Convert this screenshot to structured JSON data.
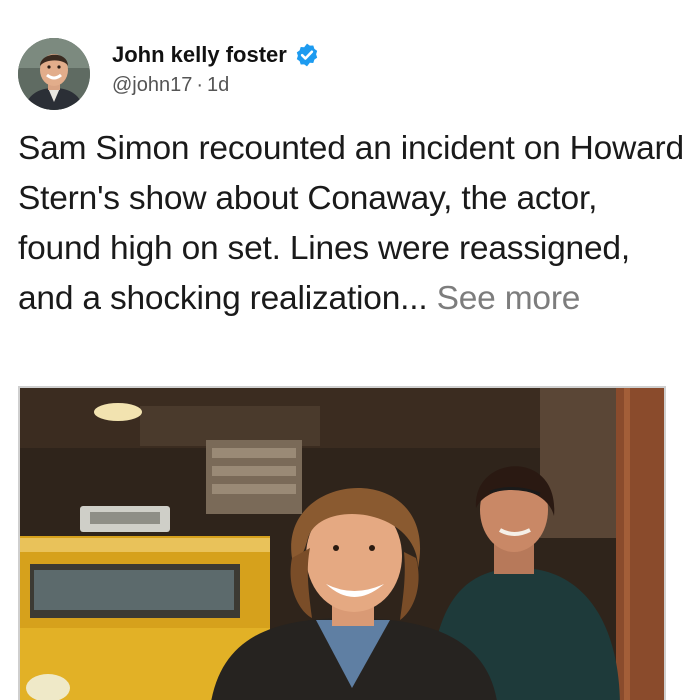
{
  "post": {
    "author_name": "John kelly foster",
    "handle": "@john17",
    "separator": "·",
    "time_ago": "1d",
    "text": "Sam Simon recounted an incident on Howard Stern's show about Conaway, the actor, found high on set. Lines were reassigned, and a shocking realization...",
    "see_more_label": "See more"
  },
  "icons": {
    "verified": "verified-badge-icon",
    "verified_color": "#1d9bf0"
  },
  "colors": {
    "text": "#1a1a1a",
    "muted": "#7d7d7d"
  }
}
